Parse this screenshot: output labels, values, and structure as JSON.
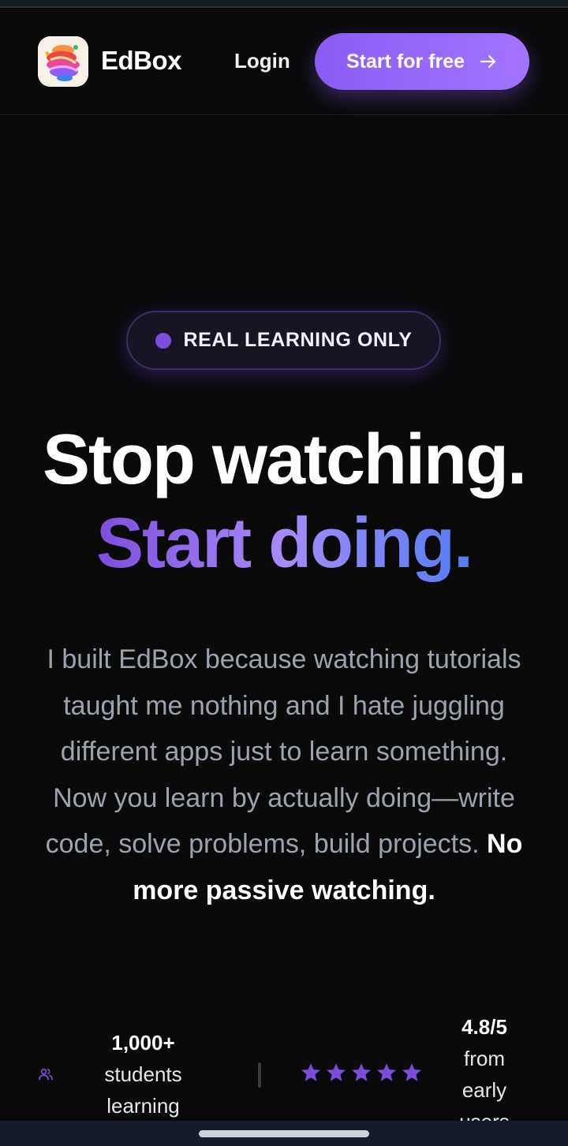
{
  "header": {
    "brand": "EdBox",
    "login_label": "Login",
    "cta_label": "Start for free",
    "cta_icon": "arrow-right-icon"
  },
  "badge": {
    "text": "REAL LEARNING ONLY"
  },
  "hero": {
    "line1": "Stop watching.",
    "line2": "Start doing.",
    "description": "I built EdBox because watching tutorials taught me nothing and I hate juggling different apps just to learn something. Now you learn by actually doing—write code, solve problems, build projects.",
    "description_strong": "No more passive watching."
  },
  "stats": {
    "students_count": "1,000+",
    "students_label": "students learning",
    "rating": "4.8/5",
    "rating_label": "from early users",
    "stars": 5
  },
  "colors": {
    "background": "#0a0a0b",
    "accent": "#8b5cf6",
    "gradient_start": "#7c4ddc",
    "gradient_end": "#4f7df2",
    "muted_text": "#9ca3af"
  }
}
